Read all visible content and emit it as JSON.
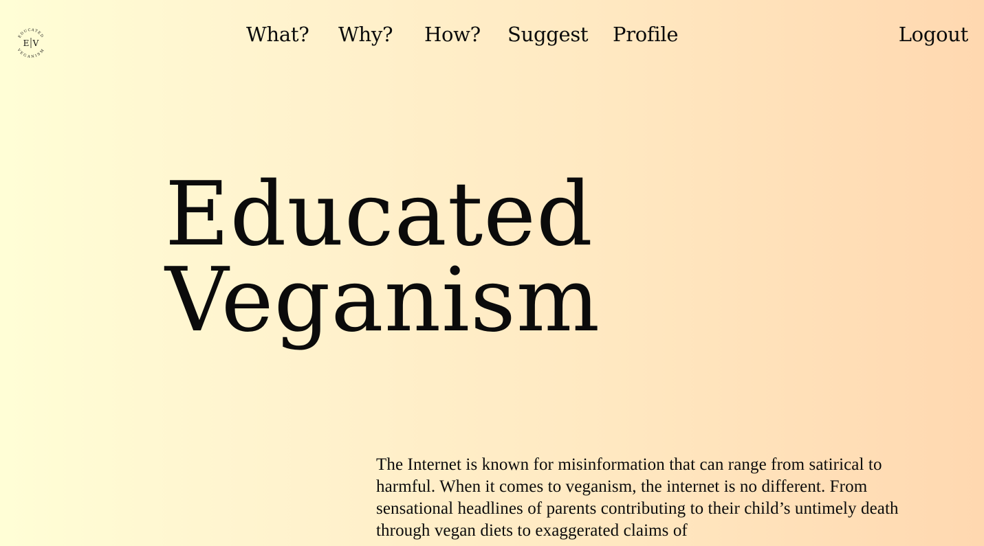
{
  "logo": {
    "top_text": "EDUCATED",
    "bottom_text": "VEGANISM",
    "left_letter": "E",
    "right_letter": "V"
  },
  "nav": {
    "items": [
      {
        "label": "What?"
      },
      {
        "label": "Why?"
      },
      {
        "label": "How?"
      },
      {
        "label": "Suggest"
      },
      {
        "label": "Profile"
      }
    ],
    "logout": "Logout"
  },
  "hero": {
    "line1": "Educated",
    "line2": "Veganism"
  },
  "intro": {
    "text": "The Internet is known for misinformation that can range from satirical to harmful. When it comes to veganism, the internet is no different. From sensational headlines of parents contributing to their child’s untimely death through vegan diets to exaggerated claims of"
  }
}
